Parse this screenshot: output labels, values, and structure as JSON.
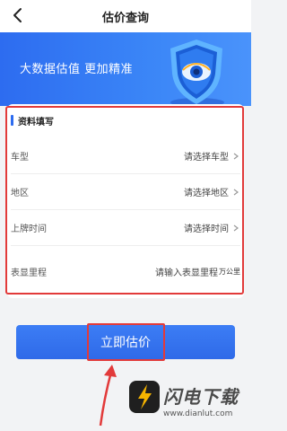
{
  "header": {
    "title": "估价查询",
    "back_icon": "back-arrow-icon"
  },
  "banner": {
    "slogan": "大数据估值 更加精准",
    "emblem_icon": "shield-eye-icon"
  },
  "form": {
    "section_title": "资料填写",
    "fields": [
      {
        "label": "车型",
        "value": "请选择车型",
        "icon": "chevron-right-icon"
      },
      {
        "label": "地区",
        "value": "请选择地区",
        "icon": "chevron-right-icon"
      },
      {
        "label": "上牌时间",
        "value": "请选择时间",
        "icon": "chevron-right-icon"
      },
      {
        "label": "表显里程",
        "placeholder": "请输入表显里程",
        "unit": "万公里"
      }
    ]
  },
  "submit": {
    "label": "立即估价"
  },
  "watermark": {
    "brand": "闪电下载",
    "url": "www.dianlut.com"
  },
  "colors": {
    "primary": "#2d6cf0",
    "highlight": "#e23a3a",
    "background": "#f2f3f5"
  }
}
